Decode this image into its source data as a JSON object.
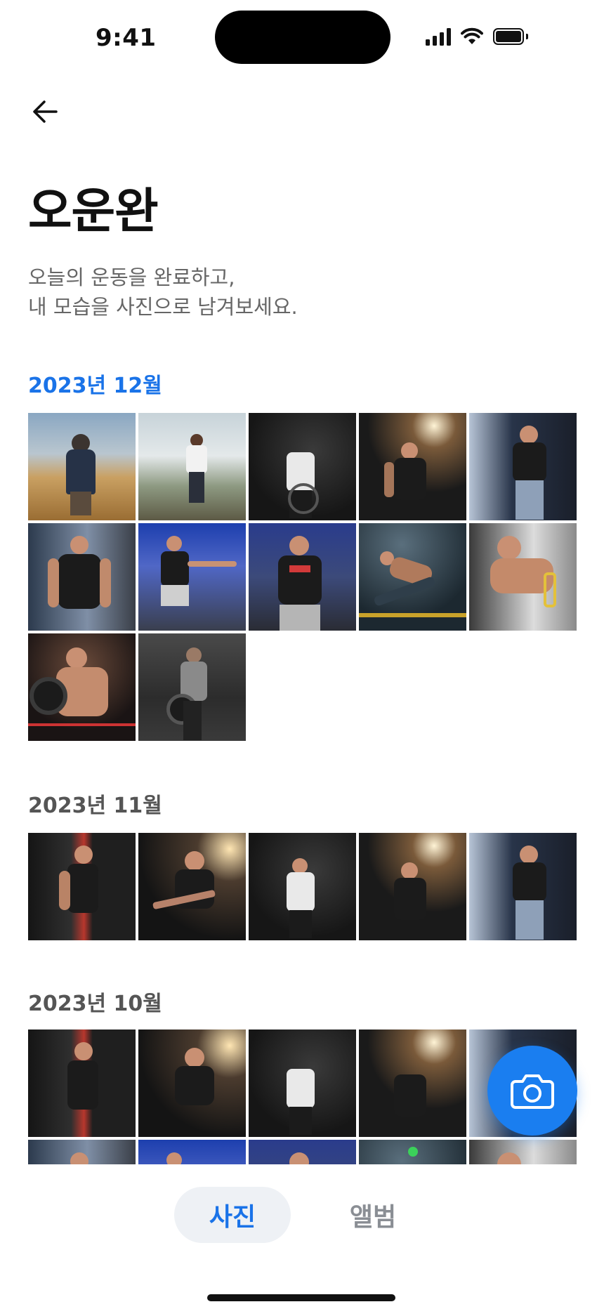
{
  "status_bar": {
    "time": "9:41"
  },
  "header": {
    "back_icon": "arrow-left-icon",
    "title": "오운완",
    "subtitle_line1": "오늘의 운동을 완료하고,",
    "subtitle_line2": "내 모습을 사진으로 남겨보세요."
  },
  "sections": [
    {
      "label": "2023년 12월",
      "active": true,
      "photo_count": 12
    },
    {
      "label": "2023년 11월",
      "active": false,
      "photo_count": 5
    },
    {
      "label": "2023년 10월",
      "active": false,
      "photo_count": 10
    }
  ],
  "fab": {
    "icon": "camera-icon"
  },
  "tabs": [
    {
      "label": "사진",
      "selected": true
    },
    {
      "label": "앨범",
      "selected": false
    }
  ],
  "colors": {
    "accent": "#1a73e8",
    "fab": "#1a7ef0",
    "text_secondary": "#666666"
  }
}
